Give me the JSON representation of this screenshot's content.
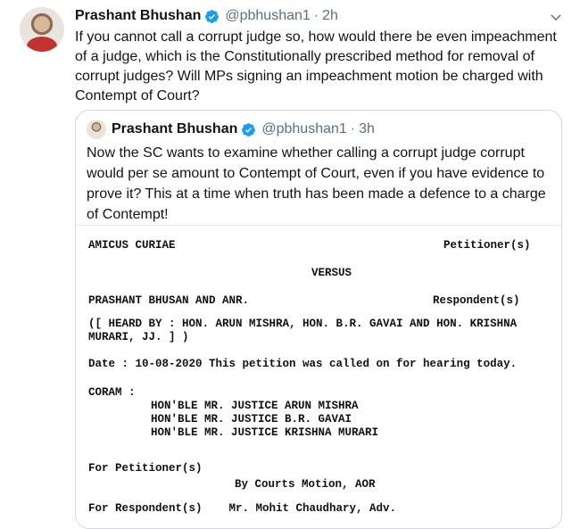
{
  "tweet": {
    "author_name": "Prashant Bhushan",
    "handle": "@pbhushan1",
    "separator": "·",
    "time": "2h",
    "text": "If you cannot call a corrupt judge so, how would there be even impeachment of a judge, which is the Constitutionally prescribed method for removal of corrupt judges? Will MPs signing an impeachment motion be charged with Contempt of Court?"
  },
  "quoted_tweet": {
    "author_name": "Prashant Bhushan",
    "handle": "@pbhushan1",
    "separator": "·",
    "time": "3h",
    "text": "Now the SC wants to examine whether calling a corrupt judge corrupt would per se amount to Contempt of Court, even if you have evidence to prove it? This at a time when truth has been made a defence to a charge of Contempt!",
    "document": {
      "petitioner_party": "AMICUS CURIAE",
      "petitioner_role": "Petitioner(s)",
      "versus": "VERSUS",
      "respondent_party": "PRASHANT BHUSAN AND ANR.",
      "respondent_role": "Respondent(s)",
      "heard_by_line1": "([ HEARD BY : HON. ARUN MISHRA, HON. B.R. GAVAI AND HON. KRISHNA",
      "heard_by_line2": "MURARI, JJ. ] )",
      "date_line": "Date : 10-08-2020 This petition was called on for hearing today.",
      "coram": "CORAM :",
      "judge1": "HON'BLE MR. JUSTICE ARUN MISHRA",
      "judge2": "HON'BLE MR. JUSTICE B.R. GAVAI",
      "judge3": "HON'BLE MR. JUSTICE KRISHNA MURARI",
      "for_petitioner": "For Petitioner(s)",
      "petitioner_counsel": "By Courts Motion, AOR",
      "for_respondent_partial": "For Respondent(s)    Mr. Mohit Chaudhary, Adv."
    }
  },
  "icons": {
    "verified": "verified-badge-icon",
    "more": "chevron-down-icon"
  },
  "colors": {
    "verified": "#1d9bf0",
    "muted": "#5b7083",
    "border": "#cfd9de"
  }
}
